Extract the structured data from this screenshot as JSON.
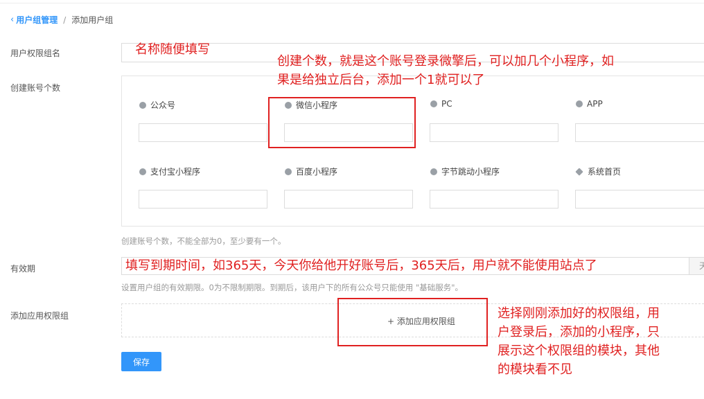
{
  "breadcrumb": {
    "parent": "用户组管理",
    "separator": "/",
    "current": "添加用户组"
  },
  "form": {
    "name_label": "用户权限组名",
    "count_label": "创建账号个数",
    "count_help": "创建账号个数，不能全部为0，至少要有一个。",
    "validity_label": "有效期",
    "validity_help": "设置用户组的有效期限。0为不限制期限。到期后，该用户下的所有公众号只能使用 \"基础服务\"。",
    "validity_suffix": "天",
    "app_group_label": "添加应用权限组",
    "add_app_group": "+ 添加应用权限组",
    "save": "保存"
  },
  "account_types": [
    {
      "label": "公众号",
      "icon": "wechat-official-icon"
    },
    {
      "label": "微信小程序",
      "icon": "wechat-miniprogram-icon"
    },
    {
      "label": "PC",
      "icon": "pc-icon"
    },
    {
      "label": "APP",
      "icon": "app-icon"
    },
    {
      "label": "支付宝小程序",
      "icon": "alipay-icon"
    },
    {
      "label": "百度小程序",
      "icon": "baidu-icon"
    },
    {
      "label": "字节跳动小程序",
      "icon": "bytedance-icon"
    },
    {
      "label": "系统首页",
      "icon": "layers-icon"
    }
  ],
  "annotations": {
    "name_note": "名称随便填写",
    "count_note_line1": "创建个数，就是这个账号登录微擎后，可以加几个小程序，如",
    "count_note_line2": "果是给独立后台，添加一个1就可以了",
    "validity_note": "填写到期时间，如365天，今天你给他开好账号后，365天后，用户就不能使用站点了",
    "group_note_line1": "选择刚刚添加好的权限组，用",
    "group_note_line2": "户登录后，添加的小程序，只",
    "group_note_line3": "展示这个权限组的模块，其他",
    "group_note_line4": "的模块看不见"
  },
  "colors": {
    "accent": "#3296fa",
    "annotation": "#e02020"
  }
}
